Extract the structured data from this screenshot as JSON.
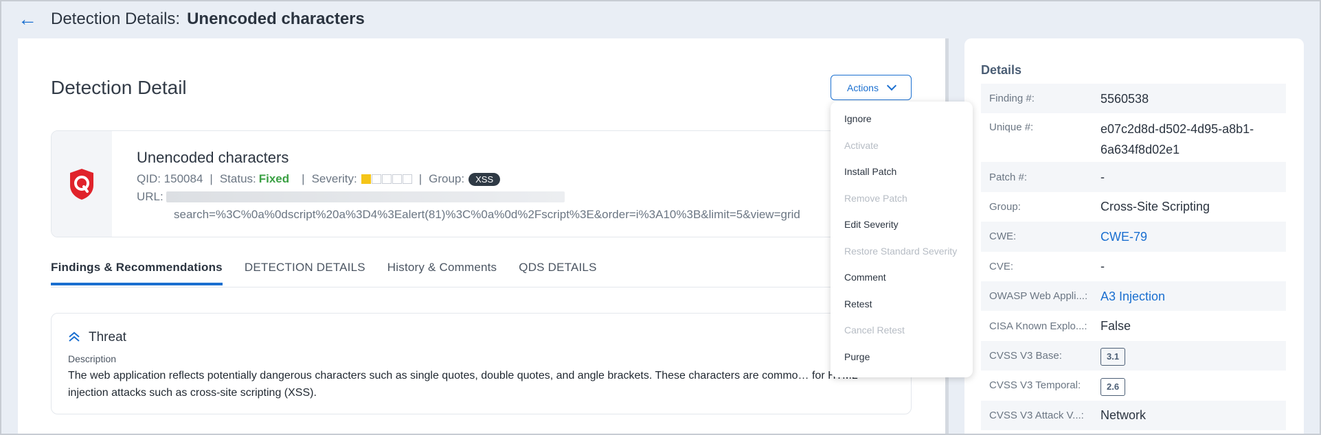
{
  "header": {
    "title_prefix": "Detection Details:",
    "title_name": "Unencoded characters"
  },
  "detail": {
    "heading": "Detection Detail",
    "actions_label": "Actions",
    "vuln_name": "Unencoded characters",
    "qid_label": "QID: 150084",
    "status_label": "Status:",
    "status_value": "Fixed",
    "severity_label": "Severity:",
    "severity_level": 1,
    "severity_max": 5,
    "group_label": "Group:",
    "group_badge": "XSS",
    "url_label": "URL:",
    "url_value": "search=%3C%0a%0dscript%20a%3D4%3Ealert(81)%3C%0a%0d%2Fscript%3E&order=i%3A10%3B&limit=5&view=grid",
    "sep": "|"
  },
  "tabs": [
    {
      "label": "Findings & Recommendations"
    },
    {
      "label": "DETECTION DETAILS"
    },
    {
      "label": "History & Comments"
    },
    {
      "label": "QDS DETAILS"
    }
  ],
  "threat": {
    "title": "Threat",
    "desc_label": "Description",
    "desc_text": "The web application reflects potentially dangerous characters such as single quotes, double quotes, and angle brackets. These characters are commo… for HTML injection attacks such as cross-site scripting (XSS)."
  },
  "menu": [
    {
      "label": "Ignore",
      "enabled": true
    },
    {
      "label": "Activate",
      "enabled": false
    },
    {
      "label": "Install Patch",
      "enabled": true
    },
    {
      "label": "Remove Patch",
      "enabled": false
    },
    {
      "label": "Edit Severity",
      "enabled": true
    },
    {
      "label": "Restore Standard Severity",
      "enabled": false
    },
    {
      "label": "Comment",
      "enabled": true
    },
    {
      "label": "Retest",
      "enabled": true
    },
    {
      "label": "Cancel Retest",
      "enabled": false
    },
    {
      "label": "Purge",
      "enabled": true
    }
  ],
  "details": {
    "heading": "Details",
    "rows": [
      {
        "label": "Finding #:",
        "value": "5560538"
      },
      {
        "label": "Unique #:",
        "value": "e07c2d8d-d502-4d95-a8b1-6a634f8d02e1"
      },
      {
        "label": "Patch #:",
        "value": "-"
      },
      {
        "label": "Group:",
        "value": "Cross-Site Scripting"
      },
      {
        "label": "CWE:",
        "value": "CWE-79"
      },
      {
        "label": "CVE:",
        "value": "-"
      },
      {
        "label": "OWASP Web Appli...:",
        "value": "A3 Injection"
      },
      {
        "label": "CISA Known Explo...:",
        "value": "False"
      },
      {
        "label": "CVSS V3 Base:",
        "value": "3.1"
      },
      {
        "label": "CVSS V3 Temporal:",
        "value": "2.6"
      },
      {
        "label": "CVSS V3 Attack V...:",
        "value": "Network"
      }
    ]
  },
  "colors": {
    "accent": "#1a6fd0",
    "status_fixed": "#3aa043",
    "severity_on": "#f5c518",
    "logo_red": "#e0232b"
  }
}
